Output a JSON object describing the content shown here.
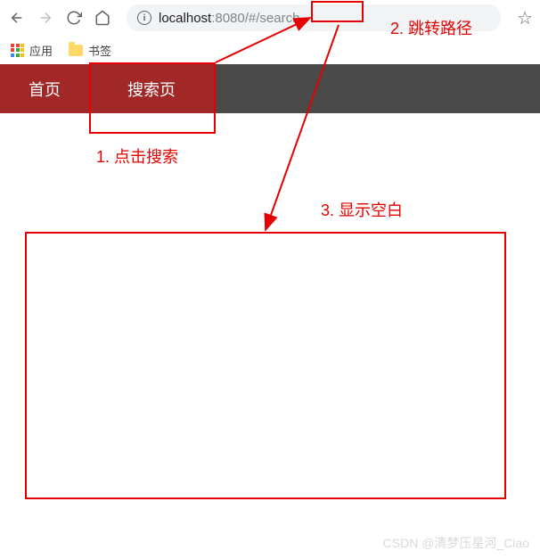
{
  "browser": {
    "url": {
      "host": "localhost",
      "port": ":8080",
      "path": "/#/search"
    }
  },
  "bookmarks": {
    "apps_label": "应用",
    "folder_label": "书签"
  },
  "nav": {
    "home": "首页",
    "search": "搜索页"
  },
  "annotations": {
    "step1": "1. 点击搜索",
    "step2": "2. 跳转路径",
    "step3": "3. 显示空白"
  },
  "watermark": "CSDN @清梦压星河_Ciao",
  "colors": {
    "annotation_red": "#e60000",
    "nav_active_bg": "#a22828",
    "nav_bg": "#4a4a4a"
  }
}
